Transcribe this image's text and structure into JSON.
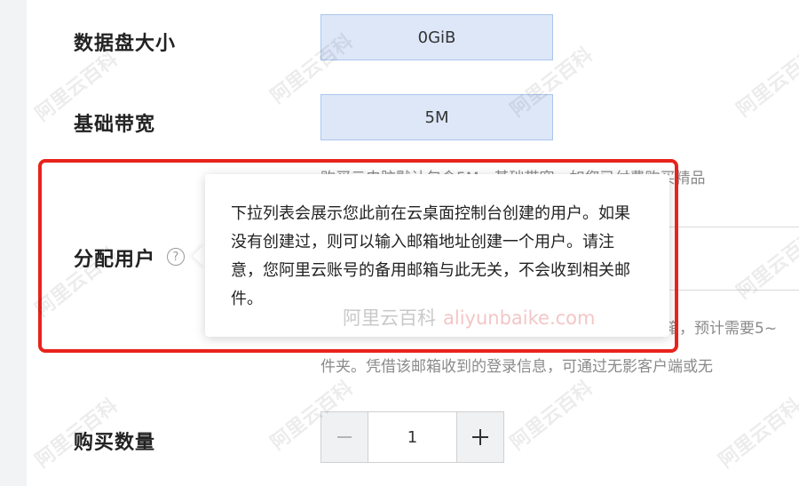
{
  "form": {
    "data_disk_size": {
      "label": "数据盘大小",
      "value": "0GiB"
    },
    "base_bandwidth": {
      "label": "基础带宽",
      "value": "5M"
    },
    "bandwidth_desc": "购买云电脑默认包含5M。基础带宽，如您已付费购买精品",
    "assign_user": {
      "label": "分配用户",
      "help_icon": "question-circle-icon",
      "desc_line1": "邮箱，预计需要5~",
      "desc_line2": "件夹。凭借该邮箱收到的登录信息，可通过无影客户端或无"
    },
    "quantity": {
      "label": "购买数量",
      "value": "1",
      "minus_icon": "minus-icon",
      "plus_icon": "plus-icon"
    }
  },
  "tooltip": {
    "text": "下拉列表会展示您此前在云桌面控制台创建的用户。如果没有创建过，则可以输入邮箱地址创建一个用户。请注意，您阿里云账号的备用邮箱与此无关，不会收到相关邮件。",
    "brand_cn": "阿里云百科",
    "brand_en": "aliyunbaike.com"
  },
  "watermark": {
    "text": "阿里云百科"
  },
  "colors": {
    "highlight": "#e8231b",
    "readonly_fill": "#dde7f8"
  }
}
